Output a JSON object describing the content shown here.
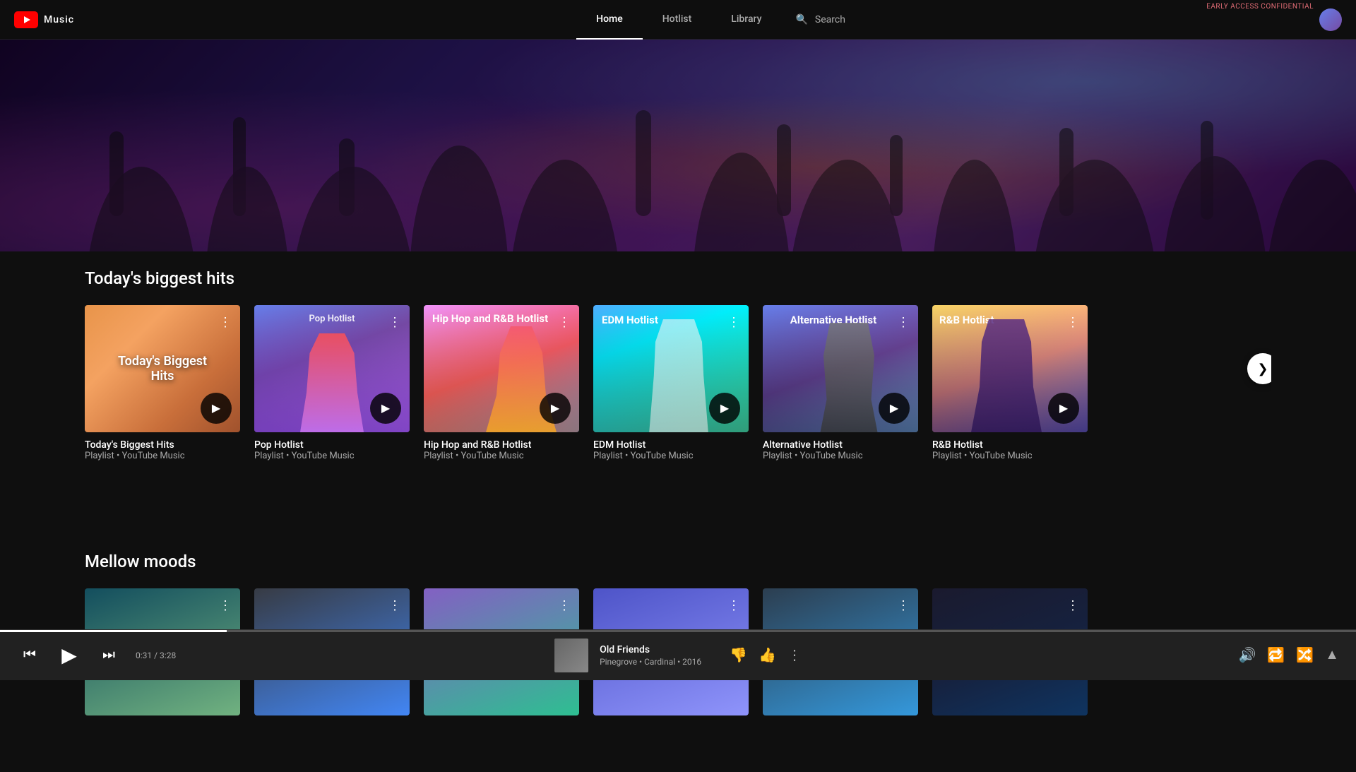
{
  "app": {
    "name": "Music",
    "logo_alt": "YouTube Music",
    "early_access": "EARLY ACCESS CONFIDENTIAL"
  },
  "navbar": {
    "items": [
      {
        "id": "home",
        "label": "Home",
        "active": true
      },
      {
        "id": "hotlist",
        "label": "Hotlist",
        "active": false
      },
      {
        "id": "library",
        "label": "Library",
        "active": false
      }
    ],
    "search_label": "Search"
  },
  "hero": {
    "visible": true
  },
  "sections": [
    {
      "id": "biggest_hits",
      "title": "Today's biggest hits",
      "cards": [
        {
          "id": "card1",
          "title": "Today's Biggest Hits",
          "subtitle": "Playlist • YouTube Music",
          "label": "Today's Biggest Hits",
          "bg_class": "card-bg-1"
        },
        {
          "id": "card2",
          "title": "Pop Hotlist",
          "subtitle": "Playlist • YouTube Music",
          "label": "Pop Hotlist",
          "bg_class": "card-bg-2"
        },
        {
          "id": "card3",
          "title": "Hip Hop and R&B Hotlist",
          "subtitle": "Playlist • YouTube Music",
          "label": "Hip Hop and R&B Hotlist",
          "bg_class": "card-bg-3"
        },
        {
          "id": "card4",
          "title": "EDM Hotlist",
          "subtitle": "Playlist • YouTube Music",
          "label": "EDM Hotlist",
          "bg_class": "card-bg-4"
        },
        {
          "id": "card5",
          "title": "Alternative Hotlist",
          "subtitle": "Playlist • YouTube Music",
          "label": "Alternative Hotlist",
          "bg_class": "card-bg-5"
        },
        {
          "id": "card6",
          "title": "R&B Hotlist",
          "subtitle": "Playlist • YouTube Music",
          "label": "R&B Hotlist",
          "bg_class": "card-bg-6"
        }
      ]
    },
    {
      "id": "mellow_moods",
      "title": "Mellow moods",
      "cards": [
        {
          "id": "mellow1",
          "title": "",
          "subtitle": "",
          "label": "",
          "bg_class": "card-mellow-1"
        },
        {
          "id": "mellow2",
          "title": "",
          "subtitle": "",
          "label": "",
          "bg_class": "card-mellow-2"
        },
        {
          "id": "mellow3",
          "title": "",
          "subtitle": "",
          "label": "",
          "bg_class": "card-mellow-3"
        },
        {
          "id": "mellow4",
          "title": "",
          "subtitle": "",
          "label": "",
          "bg_class": "card-mellow-4"
        },
        {
          "id": "mellow5",
          "title": "",
          "subtitle": "",
          "label": "",
          "bg_class": "card-mellow-5"
        },
        {
          "id": "mellow6",
          "title": "",
          "subtitle": "",
          "label": "",
          "bg_class": "card-mellow-6"
        }
      ]
    }
  ],
  "player": {
    "track_title": "Old Friends",
    "track_artist": "Pinegrove",
    "track_album": "Cardinal",
    "track_year": "2016",
    "track_meta": "Pinegrove • Cardinal • 2016",
    "current_time": "0:31",
    "total_time": "3:28",
    "time_display": "0:31 / 3:28",
    "progress_percent": 16.7
  },
  "icons": {
    "play": "▶",
    "pause": "⏸",
    "prev": "⏮",
    "next": "⏭",
    "skip_back": "⏮",
    "skip_forward": "⏭",
    "volume": "🔊",
    "repeat": "🔁",
    "shuffle": "🔀",
    "more_vert": "⋮",
    "thumb_up": "👍",
    "thumb_down": "👎",
    "expand": "▲",
    "search": "🔍",
    "chevron_right": "❯"
  }
}
